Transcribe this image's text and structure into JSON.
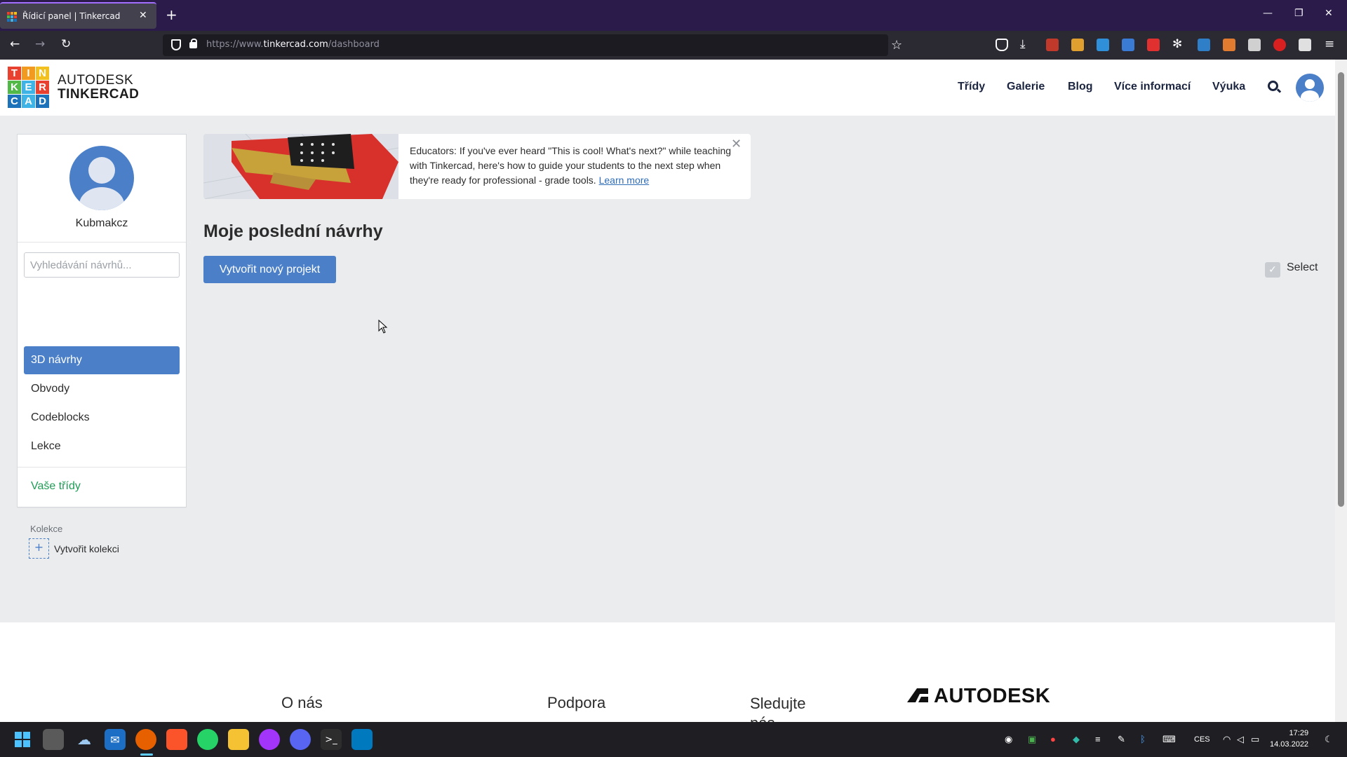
{
  "browser": {
    "tab_title": "Řídicí panel | Tinkercad",
    "url_prefix": "https://www.",
    "url_domain": "tinkercad.com",
    "url_path": "/dashboard"
  },
  "header": {
    "logo_letters": [
      "T",
      "I",
      "N",
      "K",
      "E",
      "R",
      "C",
      "A",
      "D"
    ],
    "logo_line1": "AUTODESK",
    "logo_line2": "TINKERCAD",
    "nav": [
      "Třídy",
      "Galerie",
      "Blog",
      "Více informací",
      "Výuka"
    ]
  },
  "sidebar": {
    "username": "Kubmakcz",
    "search_placeholder": "Vyhledávání návrhů...",
    "items": [
      "3D návrhy",
      "Obvody",
      "Codeblocks",
      "Lekce"
    ],
    "classes_link": "Vaše třídy",
    "collections_label": "Kolekce",
    "create_collection": "Vytvořit kolekci"
  },
  "banner": {
    "text": "Educators: If you've ever heard \"This is cool! What's next?\" while teaching with Tinkercad, here's how to guide your students to the next step when they're ready for professional - grade tools.",
    "link": "Learn more"
  },
  "main": {
    "title": "Moje poslední návrhy",
    "create_button": "Vytvořit nový projekt",
    "select_label": "Select"
  },
  "footer": {
    "col1": "O nás",
    "col2": "Podpora",
    "col3": "Sledujte nás",
    "brand": "AUTODESK"
  },
  "taskbar": {
    "lang": "CES",
    "time": "17:29",
    "date": "14.03.2022"
  },
  "colors": {
    "accent": "#4b80c9",
    "green": "#1f9d55",
    "logo": [
      "#e8412f",
      "#f29a1f",
      "#f2c11f",
      "#52b848",
      "#3db4e5",
      "#e8412f",
      "#1d73b9",
      "#3db4e5",
      "#1d73b9"
    ]
  }
}
